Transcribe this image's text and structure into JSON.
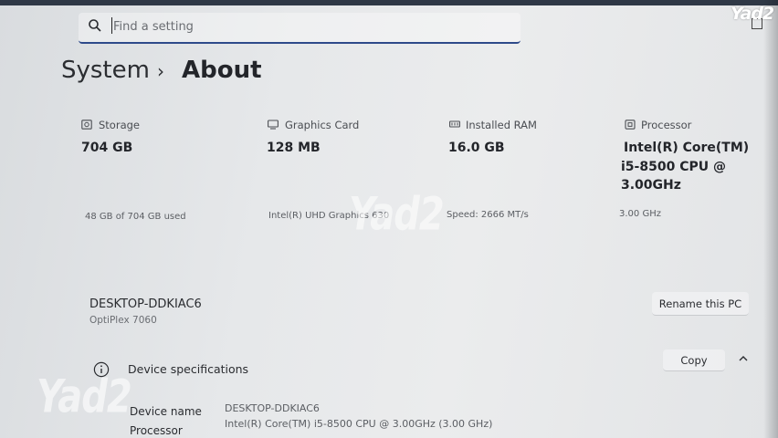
{
  "search": {
    "placeholder": "Find a setting"
  },
  "breadcrumb": {
    "parent": "System",
    "separator": "›",
    "current": "About"
  },
  "cards": {
    "storage": {
      "title": "Storage",
      "value": "704 GB",
      "detail": "48 GB of 704 GB used",
      "icon": "storage-icon"
    },
    "graphics": {
      "title": "Graphics Card",
      "value": "128 MB",
      "detail": "Intel(R) UHD Graphics 630",
      "icon": "graphics-card-icon"
    },
    "ram": {
      "title": "Installed RAM",
      "value": "16.0 GB",
      "detail": "Speed: 2666 MT/s",
      "icon": "ram-icon"
    },
    "processor": {
      "title": "Processor",
      "value_lines": [
        "Intel(R) Core(TM)",
        "i5-8500 CPU @",
        "3.00GHz"
      ],
      "detail": "3.00 GHz",
      "icon": "processor-icon"
    }
  },
  "device": {
    "name": "DESKTOP-DDKIAC6",
    "model": "OptiPlex 7060",
    "rename_label": "Rename this PC"
  },
  "specs": {
    "title": "Device specifications",
    "copy_label": "Copy",
    "rows": [
      {
        "label": "Device name",
        "value": "DESKTOP-DDKIAC6"
      },
      {
        "label": "Processor",
        "value": "Intel(R) Core(TM) i5-8500 CPU @ 3.00GHz (3.00 GHz)"
      }
    ]
  },
  "watermark": {
    "text": "Yad2"
  },
  "colors": {
    "accent": "#2e4a8a",
    "background": "#e6e8ea",
    "text": "#2a2c30"
  }
}
